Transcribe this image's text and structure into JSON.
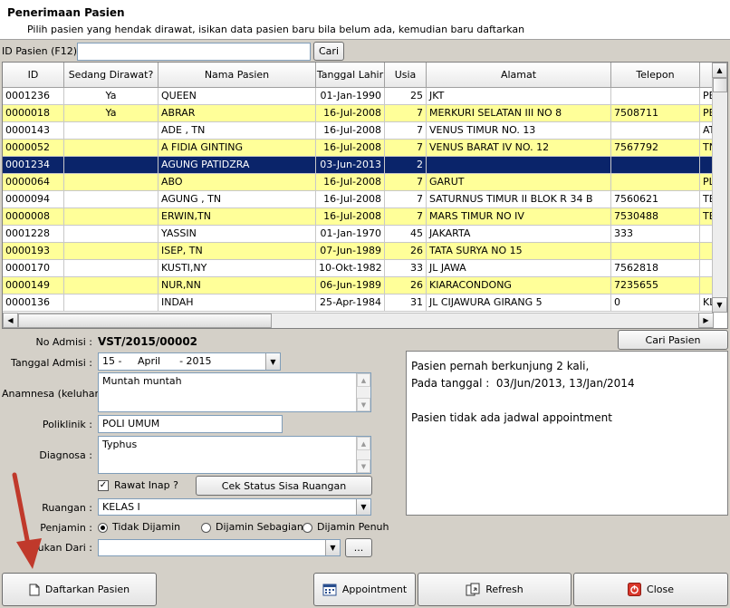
{
  "header": {
    "title": "Penerimaan Pasien",
    "subtitle": "Pilih pasien yang hendak dirawat, isikan data pasien baru bila belum ada, kemudian baru daftarkan"
  },
  "search": {
    "label": "ID Pasien (F12) :",
    "value": "",
    "button": "Cari"
  },
  "grid": {
    "columns": [
      "ID",
      "Sedang Dirawat?",
      "Nama Pasien",
      "Tanggal Lahir",
      "Usia",
      "Alamat",
      "Telepon",
      ""
    ],
    "rows": [
      {
        "id": "0001236",
        "sed": "Ya",
        "nama": "QUEEN",
        "tgl": "01-Jan-1990",
        "usia": "25",
        "alamat": "JKT",
        "telp": "",
        "x": "PE"
      },
      {
        "id": "0000018",
        "sed": "Ya",
        "nama": "ABRAR",
        "tgl": "16-Jul-2008",
        "usia": "7",
        "alamat": "MERKURI SELATAN III NO 8",
        "telp": "7508711",
        "x": "PE"
      },
      {
        "id": "0000143",
        "sed": "",
        "nama": "ADE , TN",
        "tgl": "16-Jul-2008",
        "usia": "7",
        "alamat": "VENUS TIMUR NO. 13",
        "telp": "",
        "x": "AT"
      },
      {
        "id": "0000052",
        "sed": "",
        "nama": "A FIDIA GINTING",
        "tgl": "16-Jul-2008",
        "usia": "7",
        "alamat": "VENUS BARAT IV NO. 12",
        "telp": "7567792",
        "x": "TN"
      },
      {
        "id": "0001234",
        "sed": "",
        "nama": "AGUNG PATIDZRA",
        "tgl": "03-Jun-2013",
        "usia": "2",
        "alamat": "",
        "telp": "",
        "x": ""
      },
      {
        "id": "0000064",
        "sed": "",
        "nama": "ABO",
        "tgl": "16-Jul-2008",
        "usia": "7",
        "alamat": "GARUT",
        "telp": "",
        "x": "PLI"
      },
      {
        "id": "0000094",
        "sed": "",
        "nama": "AGUNG , TN",
        "tgl": "16-Jul-2008",
        "usia": "7",
        "alamat": "SATURNUS TIMUR II BLOK R 34 B",
        "telp": "7560621",
        "x": "TE"
      },
      {
        "id": "0000008",
        "sed": "",
        "nama": "ERWIN,TN",
        "tgl": "16-Jul-2008",
        "usia": "7",
        "alamat": "MARS TIMUR NO IV",
        "telp": "7530488",
        "x": "TE"
      },
      {
        "id": "0001228",
        "sed": "",
        "nama": "YASSIN",
        "tgl": "01-Jan-1970",
        "usia": "45",
        "alamat": "JAKARTA",
        "telp": "333",
        "x": ""
      },
      {
        "id": "0000193",
        "sed": "",
        "nama": "ISEP, TN",
        "tgl": "07-Jun-1989",
        "usia": "26",
        "alamat": "TATA SURYA NO 15",
        "telp": "",
        "x": ""
      },
      {
        "id": "0000170",
        "sed": "",
        "nama": "KUSTI,NY",
        "tgl": "10-Okt-1982",
        "usia": "33",
        "alamat": "JL JAWA",
        "telp": "7562818",
        "x": ""
      },
      {
        "id": "0000149",
        "sed": "",
        "nama": "NUR,NN",
        "tgl": "06-Jun-1989",
        "usia": "26",
        "alamat": "KIARACONDONG",
        "telp": "7235655",
        "x": ""
      },
      {
        "id": "0000136",
        "sed": "",
        "nama": "INDAH",
        "tgl": "25-Apr-1984",
        "usia": "31",
        "alamat": "JL CIJAWURA GIRANG 5",
        "telp": "0",
        "x": "KLI"
      }
    ]
  },
  "form": {
    "no_admisi_label": "No Admisi :",
    "no_admisi_value": "VST/2015/00002",
    "tanggal_label": "Tanggal Admisi :",
    "tanggal_value": "15 -     April      - 2015",
    "anamnesa_label": "Anamnesa (keluhan) :",
    "anamnesa_value": "Muntah muntah",
    "poliklinik_label": "Poliklinik :",
    "poliklinik_value": "POLI UMUM",
    "diagnosa_label": "Diagnosa :",
    "diagnosa_value": "Typhus",
    "rawat_inap_label": "Rawat Inap ?",
    "cek_status_button": "Cek Status Sisa Ruangan",
    "ruangan_label": "Ruangan :",
    "ruangan_value": "KELAS I",
    "penjamin_label": "Penjamin :",
    "penjamin_options": [
      "Tidak Dijamin",
      "Dijamin Sebagian",
      "Dijamin Penuh"
    ],
    "rujukan_label": "Rujukan Dari :",
    "rujukan_value": "",
    "ellipsis_button": "..."
  },
  "cari_pasien_button": "Cari Pasien",
  "info": {
    "line1": "Pasien pernah berkunjung 2 kali,",
    "line2": "Pada tanggal :  03/Jun/2013, 13/Jan/2014",
    "line3": "Pasien tidak ada jadwal appointment"
  },
  "buttons": {
    "daftarkan": "Daftarkan Pasien",
    "appointment": "Appointment",
    "refresh": "Refresh",
    "close": "Close"
  },
  "colors": {
    "alt_row": "#ffff99",
    "selected_row": "#0a246a",
    "arrow": "#c0392b"
  }
}
